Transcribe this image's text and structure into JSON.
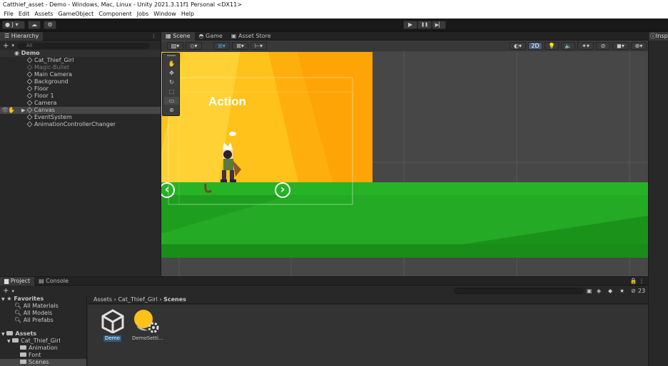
{
  "window": {
    "title": "Catthief_asset - Demo - Windows, Mac, Linux - Unity 2021.3.11f1 Personal <DX11>"
  },
  "menu": [
    "File",
    "Edit",
    "Assets",
    "GameObject",
    "Component",
    "Jobs",
    "Window",
    "Help"
  ],
  "toolbar": {
    "account": "J",
    "cloud_icon": "cloud-icon",
    "settings_icon": "gear-icon",
    "play": "▶",
    "pause": "❚❚",
    "step": "▶▏"
  },
  "hierarchy": {
    "tab": "Hierarchy",
    "add": "+",
    "search_placeholder": "All",
    "scene": "Demo",
    "items": [
      "Cat_Thief_Girl",
      "Magic-Bullet",
      "Main Camera",
      "Background",
      "Floor",
      "Floor 1",
      "Camera",
      "Canvas",
      "EventSystem",
      "AnimationControllerChanger"
    ]
  },
  "scene_tabs": [
    "Scene",
    "Game",
    "Asset Store"
  ],
  "scene_toolbar": {
    "mode_2d": "2D"
  },
  "game": {
    "action_text": "Action",
    "left_arrow": "‹",
    "right_arrow": "›"
  },
  "inspector": {
    "tab": "Insp"
  },
  "project": {
    "tabs": [
      "Project",
      "Console"
    ],
    "add": "+",
    "hidden_count": "23",
    "favorites": {
      "label": "Favorites",
      "items": [
        "All Materials",
        "All Models",
        "All Prefabs"
      ]
    },
    "assets": {
      "label": "Assets",
      "root": "Cat_Thief_Girl",
      "children": [
        "Animation",
        "Font",
        "Scenes"
      ]
    },
    "breadcrumb": [
      "Assets",
      "Cat_Thief_Girl",
      "Scenes"
    ],
    "files": [
      {
        "name": "Demo",
        "icon": "unity-scene-icon"
      },
      {
        "name": "DemoSetti...",
        "icon": "lighting-settings-icon"
      }
    ]
  },
  "colors": {
    "sky": "#ffcc00",
    "ground": "#22aa22",
    "selection": "#2c5d87"
  }
}
